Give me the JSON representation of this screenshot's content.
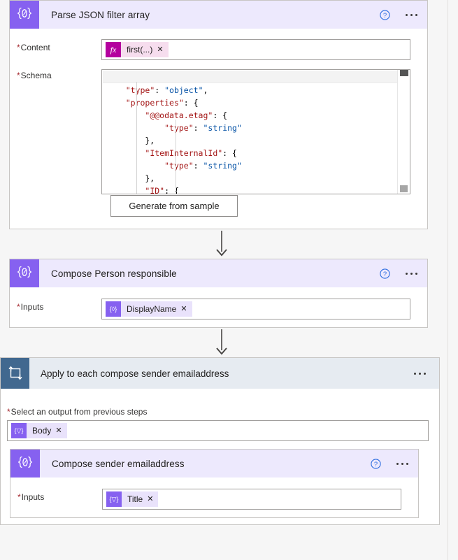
{
  "cards": {
    "parse_json": {
      "title": "Parse JSON filter array",
      "icon": "compose-braces-icon",
      "help_label": "?",
      "fields": {
        "content_label": "Content",
        "content_token": "first(...)",
        "content_token_icon": "fx",
        "schema_label": "Schema",
        "schema_value": "{\n    \"type\": \"object\",\n    \"properties\": {\n        \"@@odata.etag\": {\n            \"type\": \"string\"\n        },\n        \"ItemInternalId\": {\n            \"type\": \"string\"\n        },\n        \"ID\": {"
      },
      "generate_button": "Generate from sample"
    },
    "compose_person": {
      "title": "Compose Person responsible",
      "inputs_label": "Inputs",
      "input_token": "DisplayName",
      "input_token_icon": "{◊}"
    },
    "apply_to_each": {
      "title": "Apply to each compose sender emailaddress",
      "select_label": "Select an output from previous steps",
      "select_token": "Body",
      "select_token_icon": "{▽}"
    },
    "compose_sender": {
      "title": "Compose sender emailaddress",
      "inputs_label": "Inputs",
      "input_token": "Title",
      "input_token_icon": "{▽}"
    }
  },
  "colors": {
    "canvas": "#f6f6f6",
    "card_header": "#ede9fd",
    "card_icon_tile": "#8661f0",
    "foreach_header": "#e6ebf1",
    "foreach_icon_tile": "#41688f",
    "token_body": "#e9e2fb",
    "expression_token": "#b4009e",
    "required_asterisk": "#a4262c",
    "help_icon": "#2b6ce0",
    "connector": "#484644"
  },
  "schema_tokens": {
    "line1": "{",
    "line2_key": "\"type\"",
    "line2_val": "\"object\"",
    "line3_key": "\"properties\"",
    "line4_key": "\"@@odata.etag\"",
    "line5_key": "\"type\"",
    "line5_val": "\"string\"",
    "line7_key": "\"ItemInternalId\"",
    "line8_key": "\"type\"",
    "line8_val": "\"string\"",
    "line10_key": "\"ID\""
  }
}
